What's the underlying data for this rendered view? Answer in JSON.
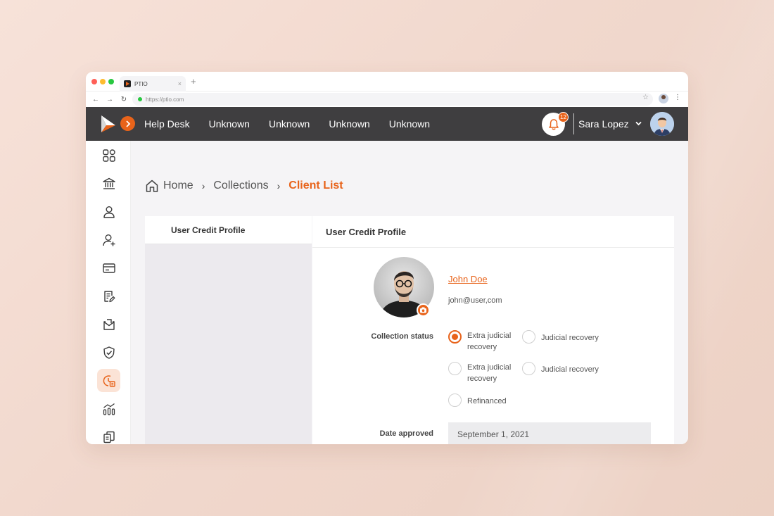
{
  "browser": {
    "tab_title": "PTIO",
    "tab_close": "×",
    "new_tab": "+",
    "url": "https://ptio.com",
    "back": "←",
    "forward": "→",
    "reload": "↻",
    "star": "☆",
    "menu": "⋮"
  },
  "topnav": {
    "links": [
      "Help Desk",
      "Unknown",
      "Unknown",
      "Unknown",
      "Unknown"
    ],
    "notification_count": "12",
    "user_name": "Sara Lopez"
  },
  "breadcrumb": {
    "home": "Home",
    "collections": "Collections",
    "current": "Client List",
    "separator": "›"
  },
  "left_panel": {
    "tab_label": "User Credit Profile"
  },
  "profile": {
    "card_title": "User Credit Profile",
    "name": "John Doe",
    "email": "john@user,com",
    "collection_status_label": "Collection status",
    "status_options": [
      {
        "label": "Extra judicial recovery",
        "checked": true
      },
      {
        "label": "Judicial recovery",
        "checked": false
      },
      {
        "label": "Extra judicial recovery",
        "checked": false
      },
      {
        "label": "Judicial recovery",
        "checked": false
      },
      {
        "label": "Refinanced",
        "checked": false
      }
    ],
    "date_approved_label": "Date approved",
    "date_approved_value": "September 1, 2021"
  },
  "colors": {
    "accent": "#e8631a",
    "nav_bg": "#3f3e40",
    "active_side_bg": "#fbe3d6"
  },
  "sidebar_icons": [
    "dashboard-icon",
    "bank-icon",
    "user-icon",
    "add-user-icon",
    "card-icon",
    "document-edit-icon",
    "mail-box-icon",
    "shield-check-icon",
    "collections-icon",
    "analytics-icon",
    "reports-icon"
  ]
}
